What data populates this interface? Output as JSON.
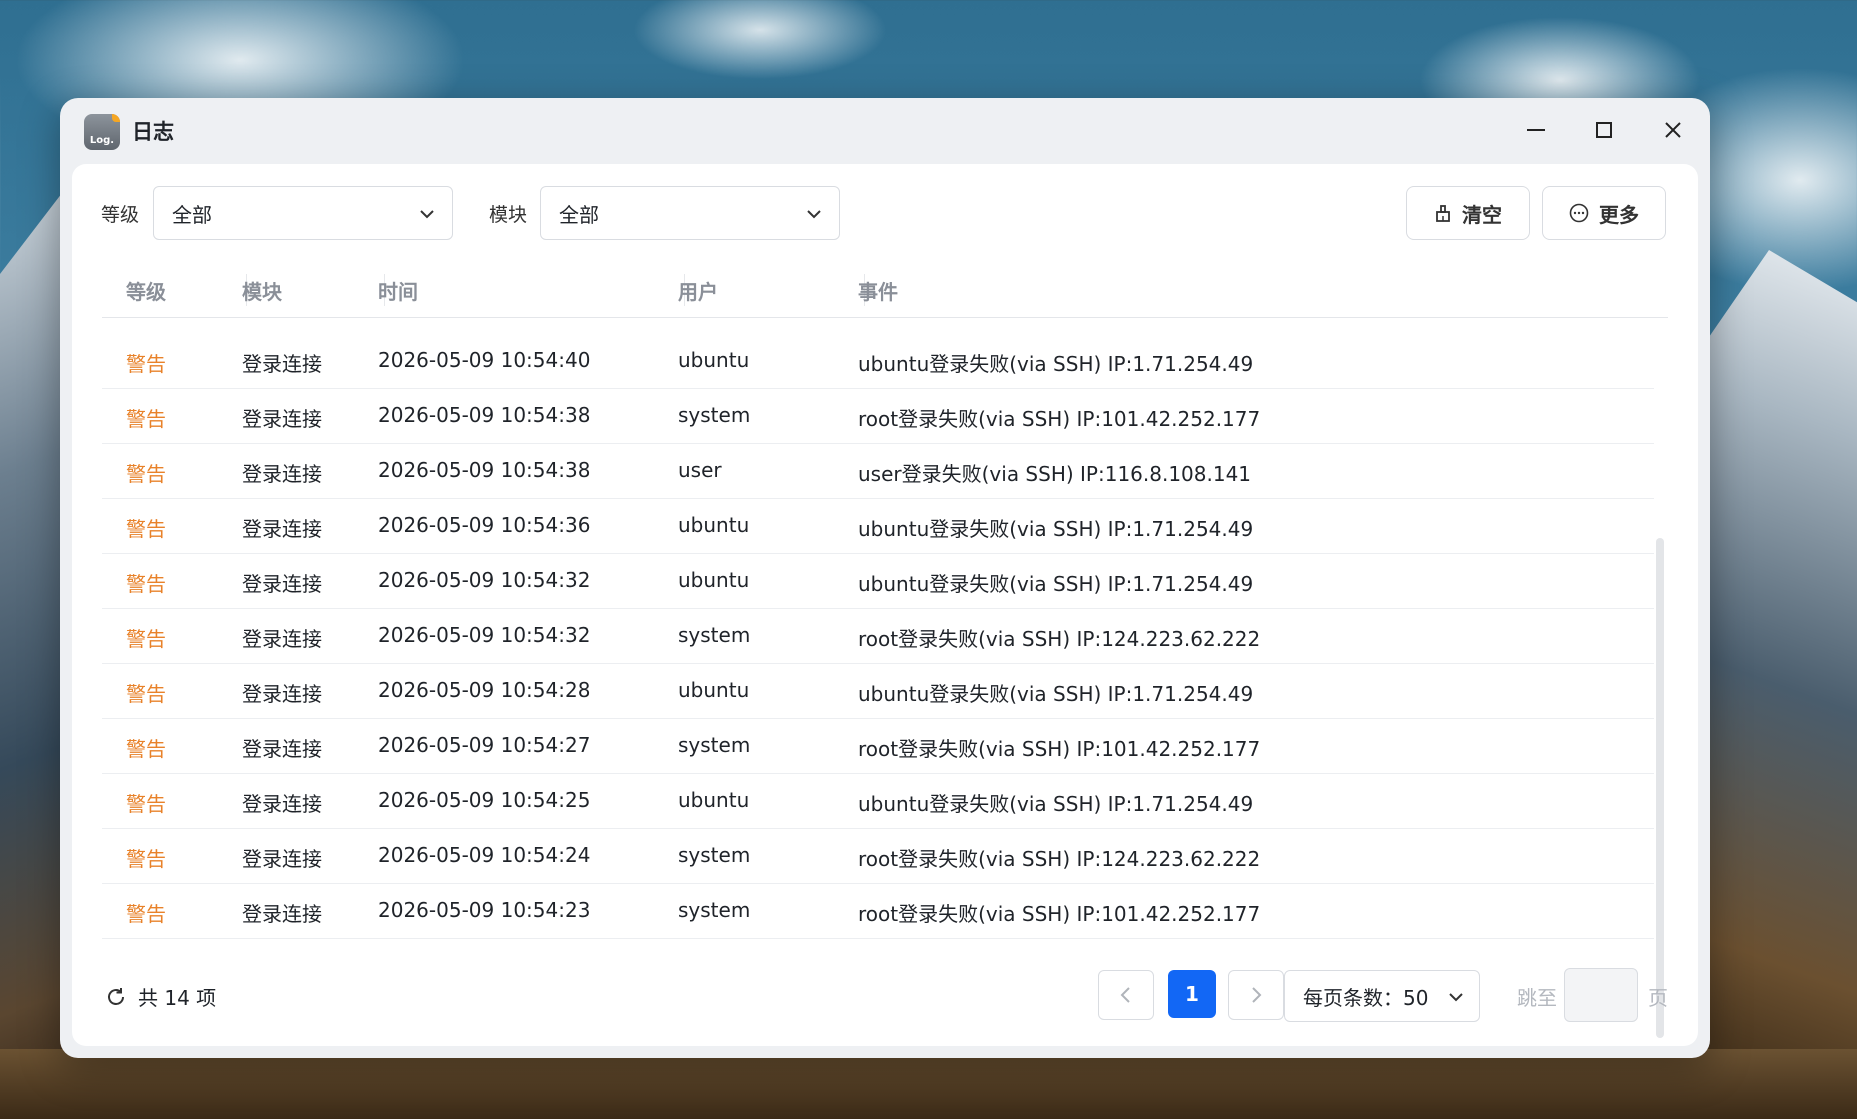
{
  "window": {
    "title": "日志",
    "app_icon_text": "Log."
  },
  "filters": {
    "level_label": "等级",
    "level_value": "全部",
    "module_label": "模块",
    "module_value": "全部"
  },
  "actions": {
    "clear_label": "清空",
    "more_label": "更多"
  },
  "table": {
    "headers": [
      "等级",
      "模块",
      "时间",
      "用户",
      "事件"
    ],
    "rows": [
      {
        "level": "警告",
        "module": "登录连接",
        "time": "2026-05-09 10:54:40",
        "user": "ubuntu",
        "event": "ubuntu登录失败(via SSH) IP:1.71.254.49"
      },
      {
        "level": "警告",
        "module": "登录连接",
        "time": "2026-05-09 10:54:38",
        "user": "system",
        "event": "root登录失败(via SSH) IP:101.42.252.177"
      },
      {
        "level": "警告",
        "module": "登录连接",
        "time": "2026-05-09 10:54:38",
        "user": "user",
        "event": "user登录失败(via SSH) IP:116.8.108.141"
      },
      {
        "level": "警告",
        "module": "登录连接",
        "time": "2026-05-09 10:54:36",
        "user": "ubuntu",
        "event": "ubuntu登录失败(via SSH) IP:1.71.254.49"
      },
      {
        "level": "警告",
        "module": "登录连接",
        "time": "2026-05-09 10:54:32",
        "user": "ubuntu",
        "event": "ubuntu登录失败(via SSH) IP:1.71.254.49"
      },
      {
        "level": "警告",
        "module": "登录连接",
        "time": "2026-05-09 10:54:32",
        "user": "system",
        "event": "root登录失败(via SSH) IP:124.223.62.222"
      },
      {
        "level": "警告",
        "module": "登录连接",
        "time": "2026-05-09 10:54:28",
        "user": "ubuntu",
        "event": "ubuntu登录失败(via SSH) IP:1.71.254.49"
      },
      {
        "level": "警告",
        "module": "登录连接",
        "time": "2026-05-09 10:54:27",
        "user": "system",
        "event": "root登录失败(via SSH) IP:101.42.252.177"
      },
      {
        "level": "警告",
        "module": "登录连接",
        "time": "2026-05-09 10:54:25",
        "user": "ubuntu",
        "event": "ubuntu登录失败(via SSH) IP:1.71.254.49"
      },
      {
        "level": "警告",
        "module": "登录连接",
        "time": "2026-05-09 10:54:24",
        "user": "system",
        "event": "root登录失败(via SSH) IP:124.223.62.222"
      },
      {
        "level": "警告",
        "module": "登录连接",
        "time": "2026-05-09 10:54:23",
        "user": "system",
        "event": "root登录失败(via SSH) IP:101.42.252.177"
      }
    ]
  },
  "footer": {
    "total_text": "共 14 项",
    "current_page": "1",
    "page_size_text": "每页条数：50",
    "jump_label": "跳至",
    "page_suffix": "页"
  },
  "colors": {
    "warning": "#e8822a",
    "primary": "#1267f5"
  }
}
